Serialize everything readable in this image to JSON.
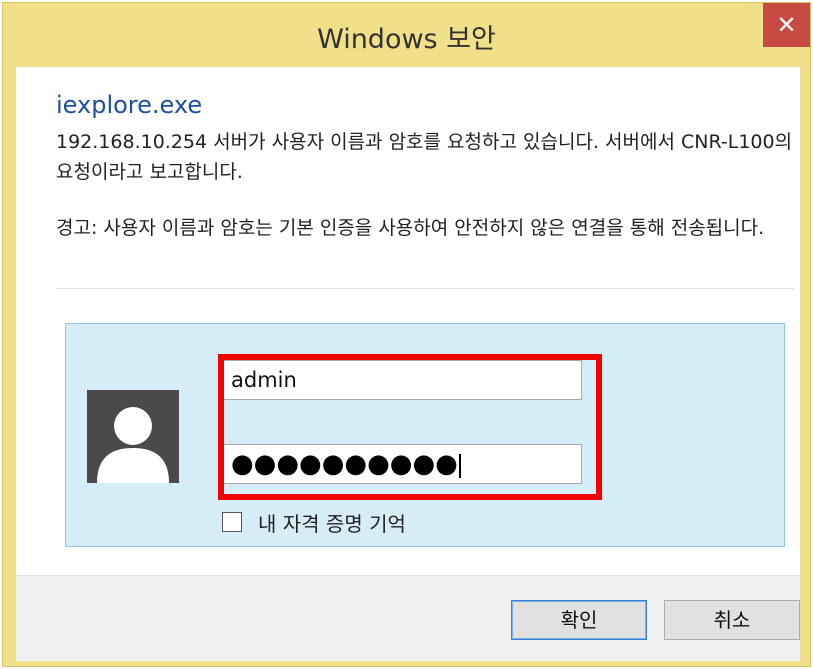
{
  "window": {
    "title": "Windows 보안",
    "close_label": "✕"
  },
  "content": {
    "app_name": "iexplore.exe",
    "message": "192.168.10.254 서버가 사용자 이름과 암호를 요청하고 있습니다. 서버에서 CNR-L100의 요청이라고 보고합니다.",
    "warning": "경고: 사용자 이름과 암호는 기본 인증을 사용하여 안전하지 않은 연결을 통해 전송됩니다."
  },
  "credentials": {
    "avatar_icon": "user-silhouette-icon",
    "username": "admin",
    "password_masked": "●●●●●●●●●●",
    "remember_label": "내 자격 증명 기억",
    "remember_checked": false
  },
  "colors": {
    "titlebar": "#f0e08a",
    "close": "#c74b43",
    "panel": "#d6ecf7",
    "highlight": "#f20000",
    "link": "#1e50a0"
  },
  "buttons": {
    "ok_label": "확인",
    "cancel_label": "취소"
  }
}
